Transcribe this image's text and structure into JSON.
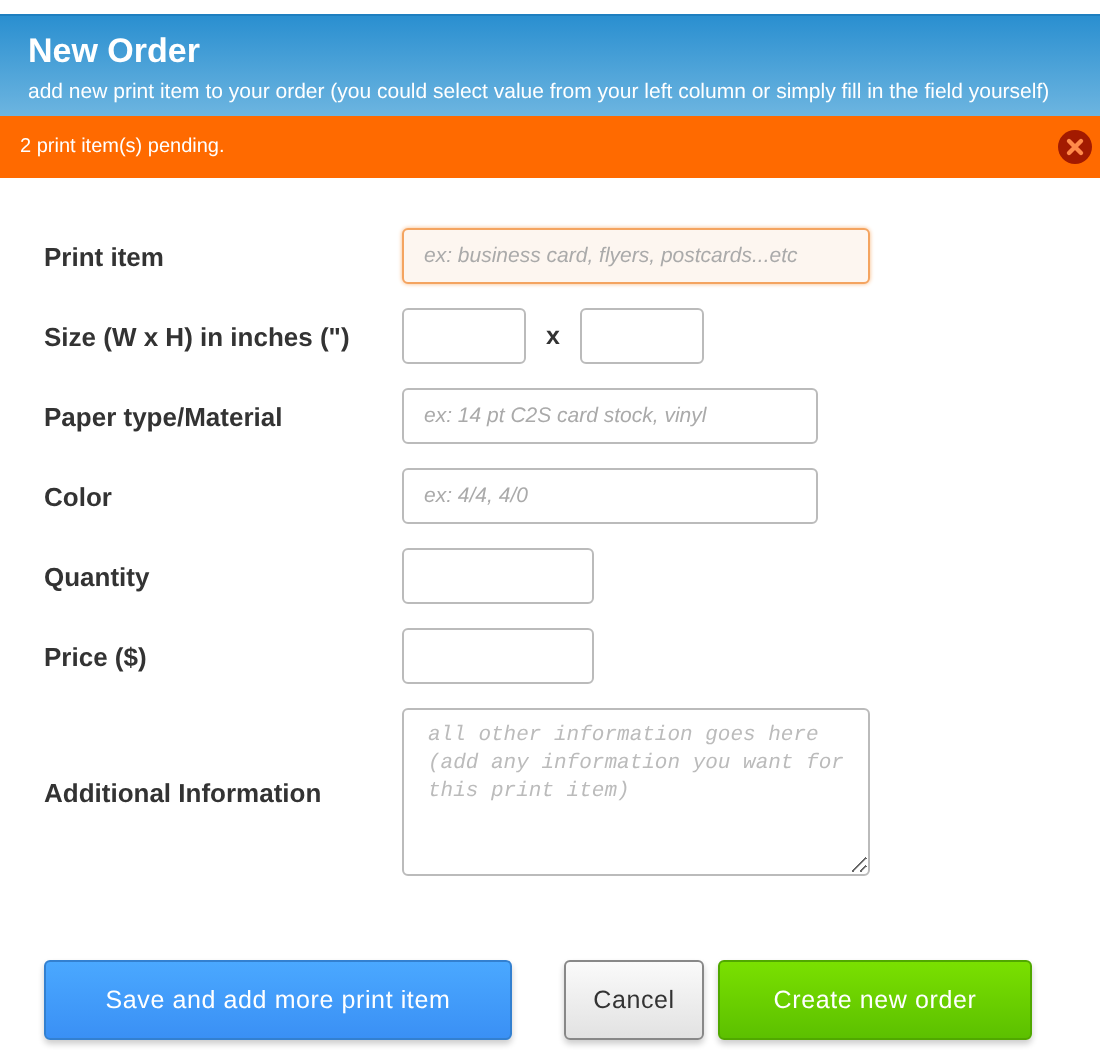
{
  "header": {
    "title": "New Order",
    "subtitle": "add new print item to your order (you could select value from your left column or simply fill in the field yourself)"
  },
  "notice": {
    "text": "2 print item(s) pending."
  },
  "fields": [
    {
      "kind": "long",
      "label": "Print item",
      "placeholder": "ex: business card, flyers, postcards...etc",
      "focused": true
    },
    {
      "kind": "size",
      "label": "Size (W x H) in inches (\")",
      "separator": "x",
      "focused": false
    },
    {
      "kind": "medium",
      "label": "Paper type/Material",
      "placeholder": "ex: 14 pt C2S card stock, vinyl",
      "focused": false
    },
    {
      "kind": "medium",
      "label": "Color",
      "placeholder": "ex: 4/4, 4/0",
      "focused": false
    },
    {
      "kind": "short",
      "label": "Quantity",
      "focused": false
    },
    {
      "kind": "short",
      "label": "Price ($)",
      "focused": false
    },
    {
      "kind": "textarea",
      "label": "Additional Information",
      "placeholder": "all other information goes here (add any information you want for this print item)",
      "focused": false
    }
  ],
  "buttons": [
    {
      "kind": "primary",
      "label": "Save and add more print item"
    },
    {
      "kind": "secondary",
      "label": "Cancel"
    },
    {
      "kind": "success",
      "label": "Create new order"
    }
  ]
}
